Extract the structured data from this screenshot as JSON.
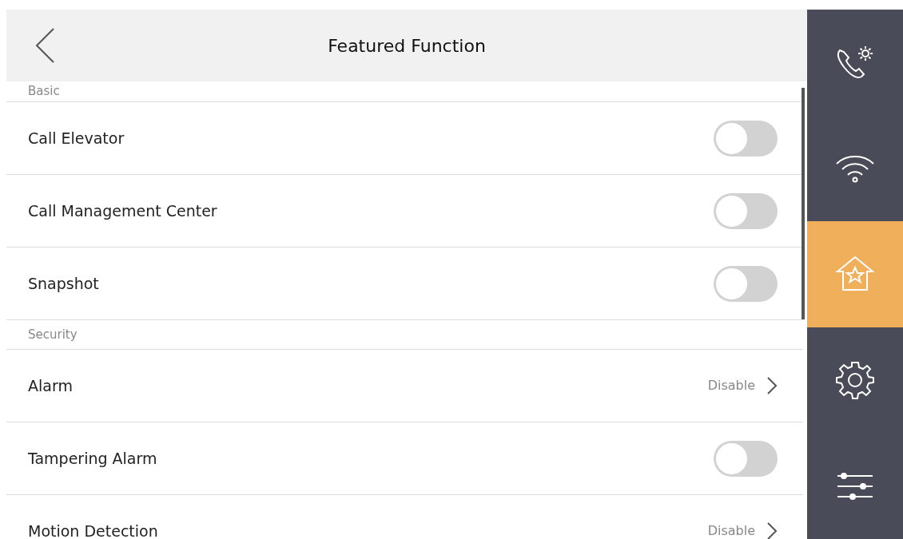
{
  "header": {
    "title": "Featured Function"
  },
  "sections": [
    {
      "label": "Basic",
      "rows": [
        {
          "kind": "toggle",
          "label": "Call Elevator",
          "on": false
        },
        {
          "kind": "toggle",
          "label": "Call Management Center",
          "on": false
        },
        {
          "kind": "toggle",
          "label": "Snapshot",
          "on": false
        }
      ]
    },
    {
      "label": "Security",
      "rows": [
        {
          "kind": "link",
          "label": "Alarm",
          "value": "Disable"
        },
        {
          "kind": "toggle",
          "label": "Tampering Alarm",
          "on": false
        },
        {
          "kind": "link",
          "label": "Motion Detection",
          "value": "Disable"
        }
      ]
    }
  ],
  "sidebar": {
    "items": [
      {
        "kind": "call-settings",
        "selected": false
      },
      {
        "kind": "network",
        "selected": false
      },
      {
        "kind": "home",
        "selected": true
      },
      {
        "kind": "settings",
        "selected": false
      },
      {
        "kind": "sliders",
        "selected": false
      }
    ]
  }
}
